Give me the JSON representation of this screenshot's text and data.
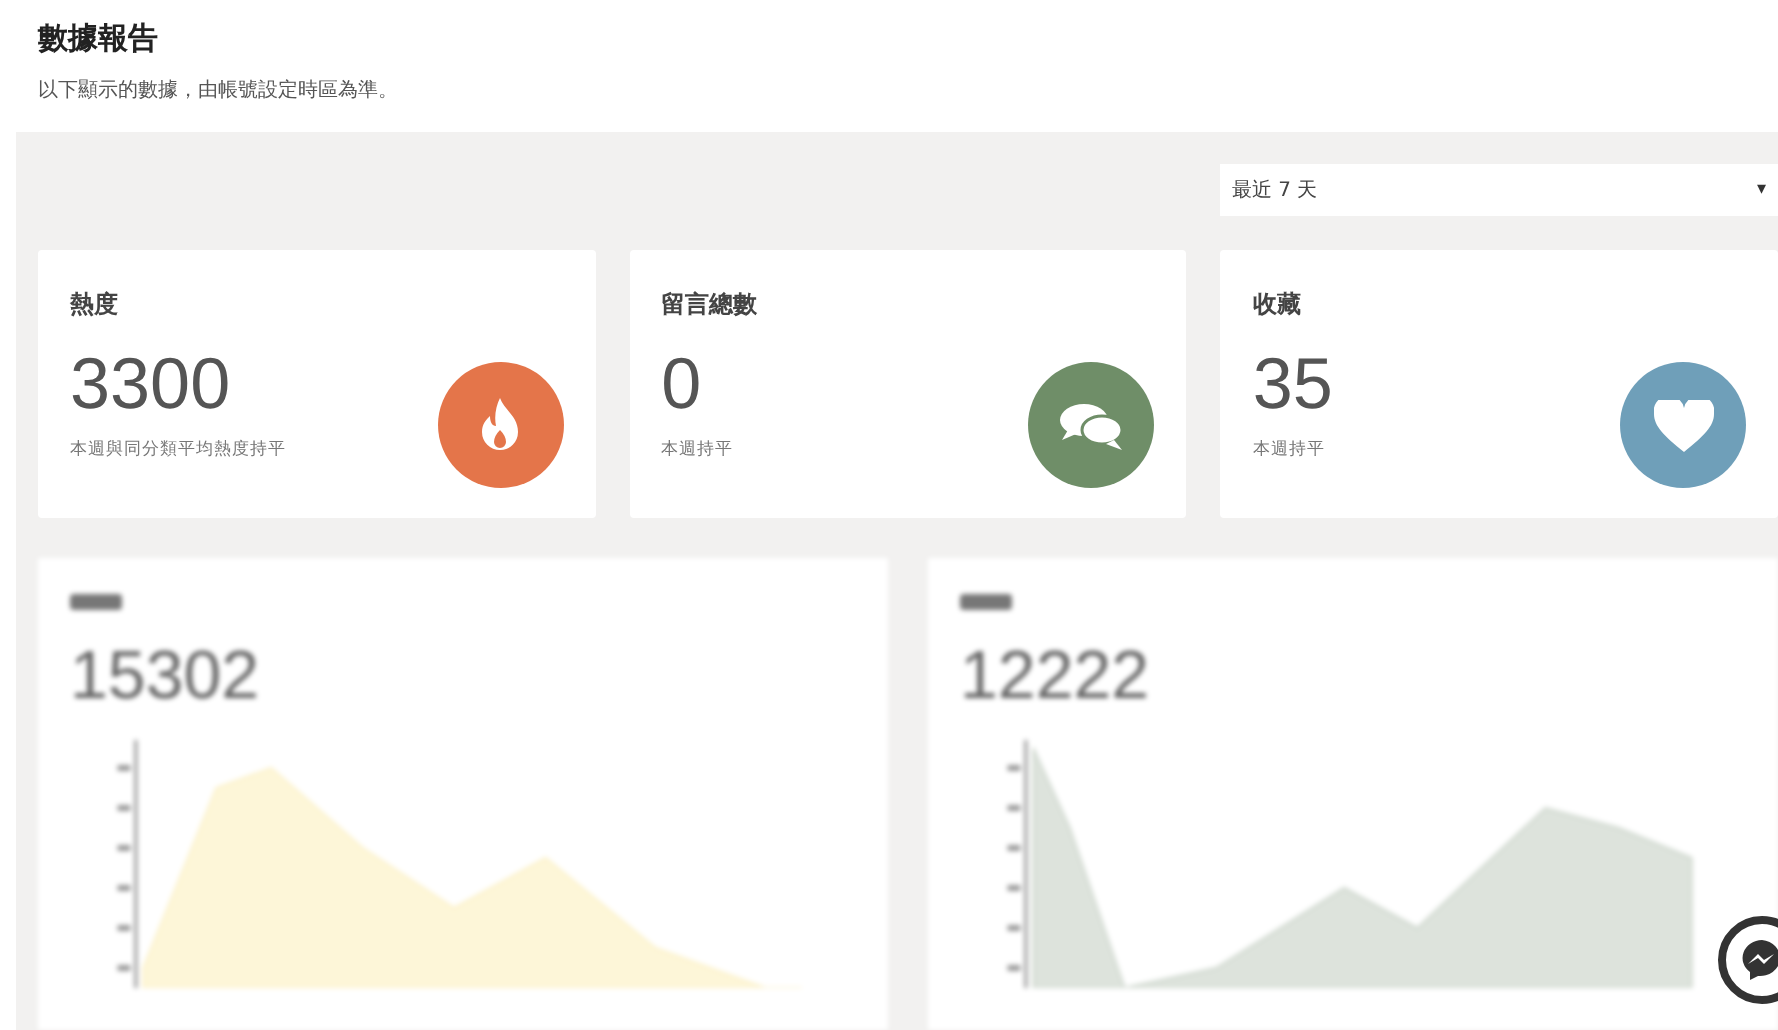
{
  "page": {
    "title": "數據報告",
    "subtitle": "以下顯示的數據，由帳號設定時區為準。"
  },
  "range_select": {
    "value": "最近 7 天",
    "caret": "▾"
  },
  "stat_cards": [
    {
      "title": "熱度",
      "value": "3300",
      "note": "本週與同分類平均熱度持平",
      "kind": "fire",
      "color": "#e4754a"
    },
    {
      "title": "留言總數",
      "value": "0",
      "note": "本週持平",
      "kind": "comments",
      "color": "#6f8e68"
    },
    {
      "title": "收藏",
      "value": "35",
      "note": "本週持平",
      "kind": "heart",
      "color": "#6f9fb9"
    }
  ],
  "chart_cards": [
    {
      "value": "15302",
      "kind": "yellow"
    },
    {
      "value": "12222",
      "kind": "green"
    }
  ]
}
